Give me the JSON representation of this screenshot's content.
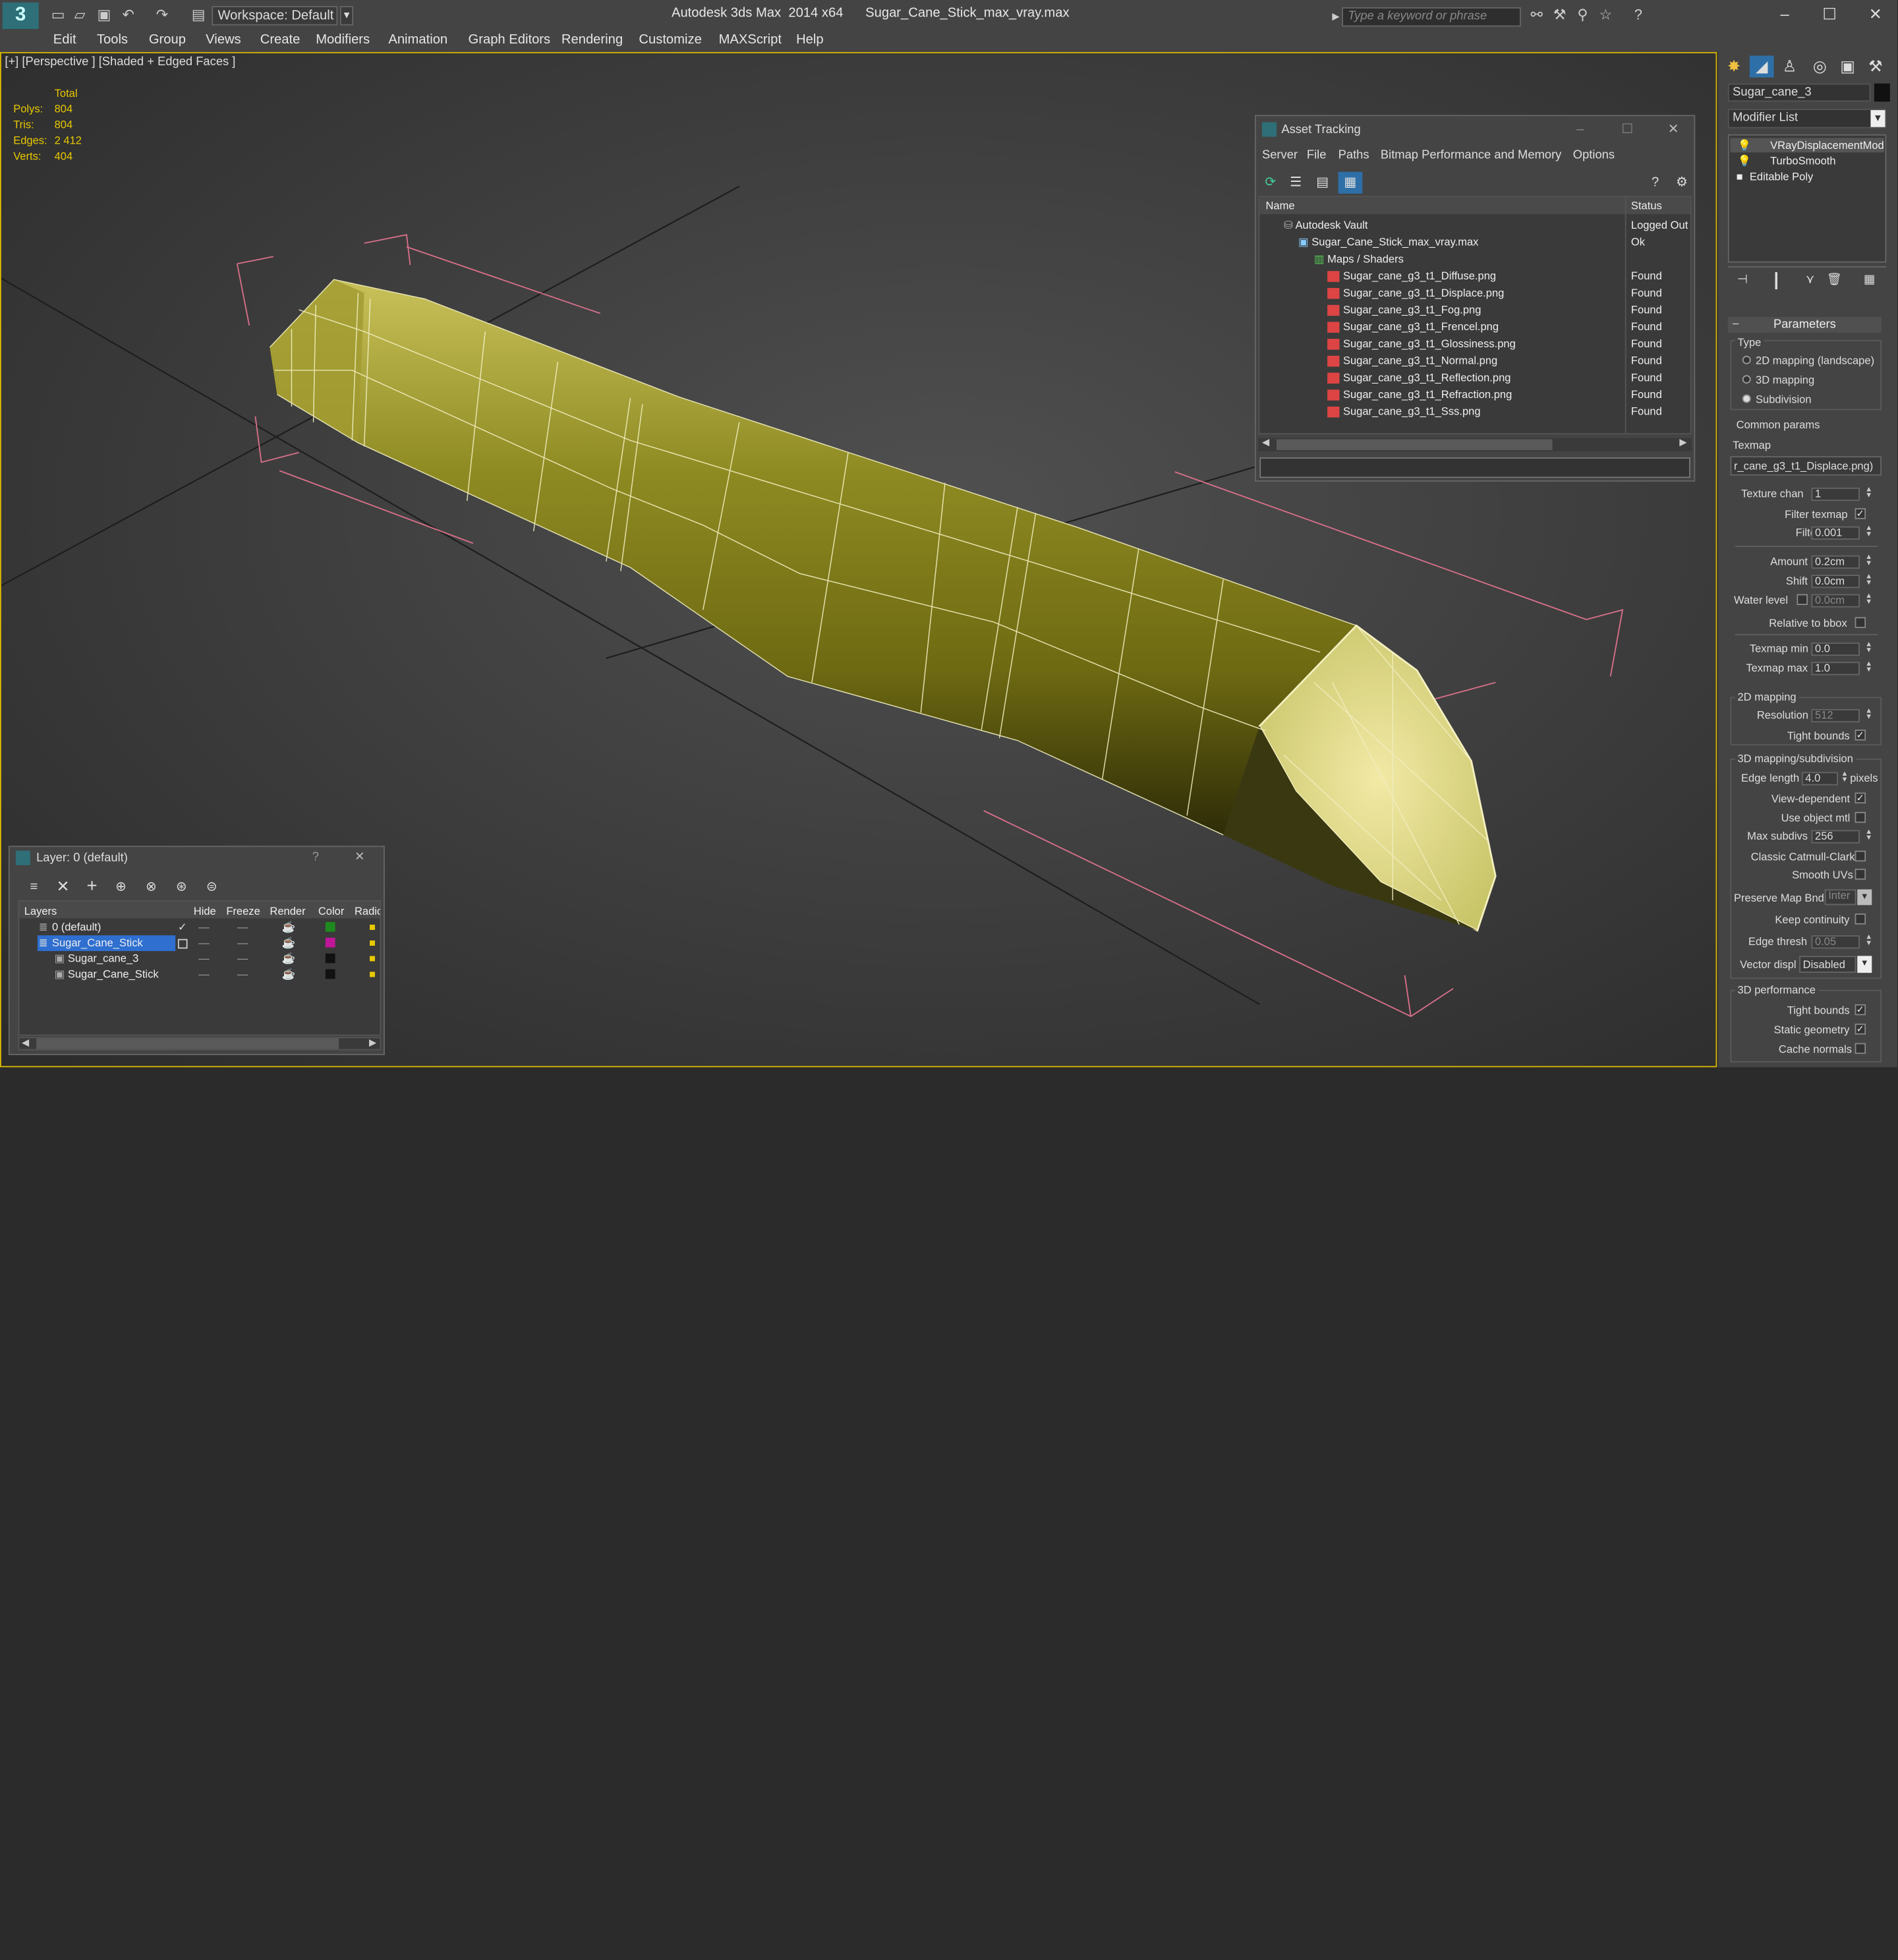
{
  "titlebar": {
    "workspace": "Workspace: Default",
    "app_title": "Autodesk 3ds Max  2014 x64",
    "file_title": "Sugar_Cane_Stick_max_vray.max",
    "search_placeholder": "Type a keyword or phrase"
  },
  "menu": [
    "Edit",
    "Tools",
    "Group",
    "Views",
    "Create",
    "Modifiers",
    "Animation",
    "Graph Editors",
    "Rendering",
    "Customize",
    "MAXScript",
    "Help"
  ],
  "viewport": {
    "label": "[+] [Perspective ] [Shaded + Edged Faces ]",
    "stats_header": "Total",
    "stats": [
      {
        "label": "Polys:",
        "value": "804"
      },
      {
        "label": "Tris:",
        "value": "804"
      },
      {
        "label": "Edges:",
        "value": "2 412"
      },
      {
        "label": "Verts:",
        "value": "404"
      }
    ]
  },
  "command_panel": {
    "object_name": "Sugar_cane_3",
    "modifier_list": "Modifier List",
    "stack": [
      "VRayDisplacementMod",
      "TurboSmooth",
      "Editable Poly"
    ],
    "params_title": "Parameters",
    "type_label": "Type",
    "type_options": [
      "2D mapping (landscape)",
      "3D mapping",
      "Subdivision"
    ],
    "common_params": "Common params",
    "texmap_label": "Texmap",
    "texmap_value": "r_cane_g3_t1_Displace.png)",
    "texture_chan_label": "Texture chan",
    "texture_chan": "1",
    "filter_texmap": "Filter texmap",
    "filter_blur_label": "Filter blur",
    "filter_blur": "0.001",
    "amount_label": "Amount",
    "amount": "0.2cm",
    "shift_label": "Shift",
    "shift": "0.0cm",
    "water_level_label": "Water level",
    "water_level": "0.0cm",
    "relative_bbox": "Relative to bbox",
    "texmap_min_label": "Texmap min",
    "texmap_min": "0.0",
    "texmap_max_label": "Texmap max",
    "texmap_max": "1.0",
    "mapping2d": "2D mapping",
    "resolution_label": "Resolution",
    "resolution": "512",
    "tight_bounds": "Tight bounds",
    "mapping3d": "3D mapping/subdivision",
    "edge_length_label": "Edge length",
    "edge_length": "4.0",
    "pixels": "pixels",
    "view_dependent": "View-dependent",
    "use_object_mtl": "Use object mtl",
    "max_subdivs_label": "Max subdivs",
    "max_subdivs": "256",
    "classic_catmull": "Classic Catmull-Clark",
    "smooth_uvs": "Smooth UVs",
    "preserve_map": "Preserve Map Bnd",
    "preserve_map_value": "Inter",
    "keep_continuity": "Keep continuity",
    "edge_thresh_label": "Edge thresh",
    "edge_thresh": "0.05",
    "vector_displ_label": "Vector displ",
    "vector_displ": "Disabled",
    "performance": "3D performance",
    "tight_bounds2": "Tight bounds",
    "static_geometry": "Static geometry",
    "cache_normals": "Cache normals"
  },
  "asset_tracking": {
    "title": "Asset Tracking",
    "menu": [
      "Server",
      "File",
      "Paths",
      "Bitmap Performance and Memory",
      "Options"
    ],
    "col_name": "Name",
    "col_status": "Status",
    "rows": [
      {
        "name": "Autodesk Vault",
        "status": "Logged Out",
        "indent": 0,
        "kind": "vault"
      },
      {
        "name": "Sugar_Cane_Stick_max_vray.max",
        "status": "Ok",
        "indent": 1,
        "kind": "max"
      },
      {
        "name": "Maps / Shaders",
        "status": "",
        "indent": 2,
        "kind": "folder"
      },
      {
        "name": "Sugar_cane_g3_t1_Diffuse.png",
        "status": "Found",
        "indent": 3,
        "kind": "png"
      },
      {
        "name": "Sugar_cane_g3_t1_Displace.png",
        "status": "Found",
        "indent": 3,
        "kind": "png"
      },
      {
        "name": "Sugar_cane_g3_t1_Fog.png",
        "status": "Found",
        "indent": 3,
        "kind": "png"
      },
      {
        "name": "Sugar_cane_g3_t1_Frencel.png",
        "status": "Found",
        "indent": 3,
        "kind": "png"
      },
      {
        "name": "Sugar_cane_g3_t1_Glossiness.png",
        "status": "Found",
        "indent": 3,
        "kind": "png"
      },
      {
        "name": "Sugar_cane_g3_t1_Normal.png",
        "status": "Found",
        "indent": 3,
        "kind": "png"
      },
      {
        "name": "Sugar_cane_g3_t1_Reflection.png",
        "status": "Found",
        "indent": 3,
        "kind": "png"
      },
      {
        "name": "Sugar_cane_g3_t1_Refraction.png",
        "status": "Found",
        "indent": 3,
        "kind": "png"
      },
      {
        "name": "Sugar_cane_g3_t1_Sss.png",
        "status": "Found",
        "indent": 3,
        "kind": "png"
      }
    ]
  },
  "layer_panel": {
    "title": "Layer: 0 (default)",
    "help": "?",
    "columns": [
      "Layers",
      "Hide",
      "Freeze",
      "Render",
      "Color",
      "Radio"
    ],
    "rows": [
      {
        "name": "0 (default)",
        "indent": 1,
        "color": "#1e8a1e",
        "selected": false
      },
      {
        "name": "Sugar_Cane_Stick",
        "indent": 1,
        "color": "#c0169a",
        "selected": true
      },
      {
        "name": "Sugar_cane_3",
        "indent": 2,
        "color": "#111111",
        "selected": false
      },
      {
        "name": "Sugar_Cane_Stick",
        "indent": 2,
        "color": "#111111",
        "selected": false
      }
    ]
  }
}
